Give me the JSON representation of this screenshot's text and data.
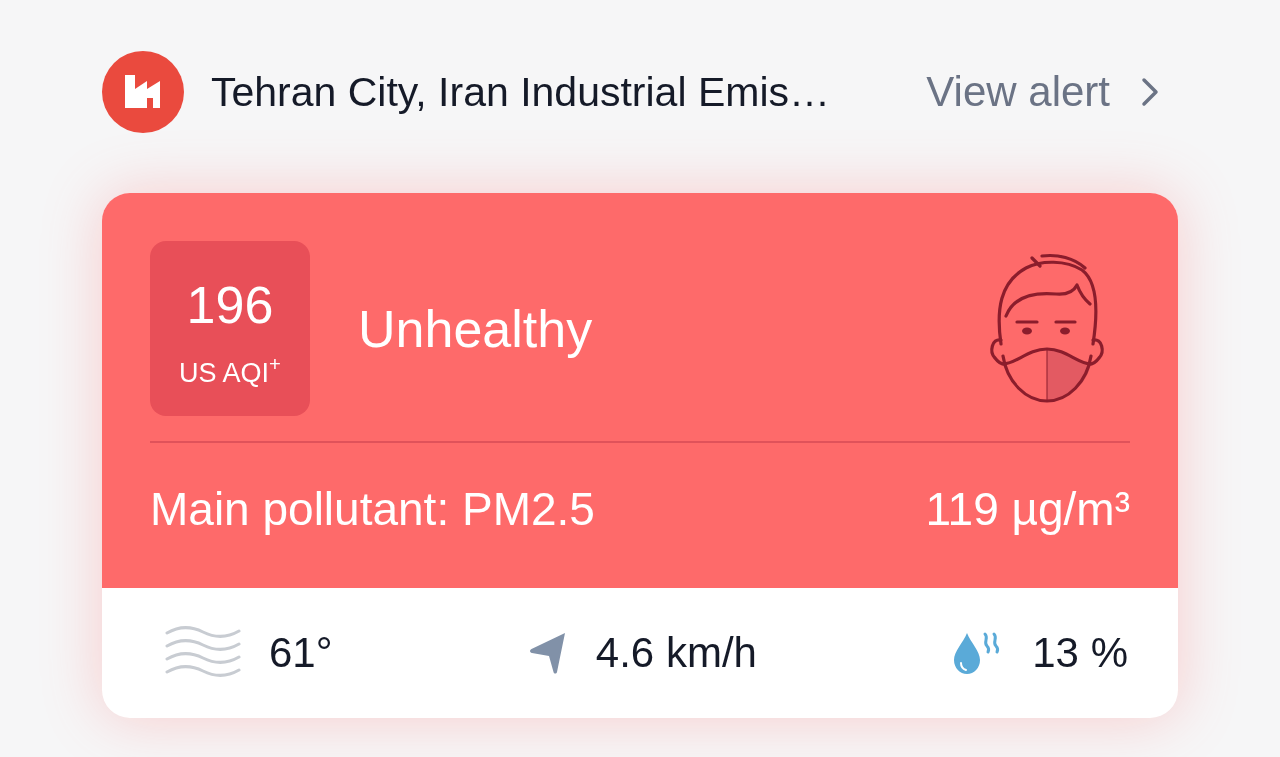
{
  "alert": {
    "title": "Tehran City, Iran Industrial Emis…",
    "action": "View alert"
  },
  "aqi_card": {
    "aqi": "196",
    "unit": "US AQI$^{+}$",
    "status": "Unhealthy",
    "main_pollutant": "Main pollutant: PM2.5",
    "concentration": "119 µg/m³"
  },
  "weather": [
    {
      "kind": "temperature",
      "value": "61°"
    },
    {
      "kind": "wind",
      "value": "4.6 km/h"
    },
    {
      "kind": "humidity",
      "value": "13 %"
    }
  ]
}
